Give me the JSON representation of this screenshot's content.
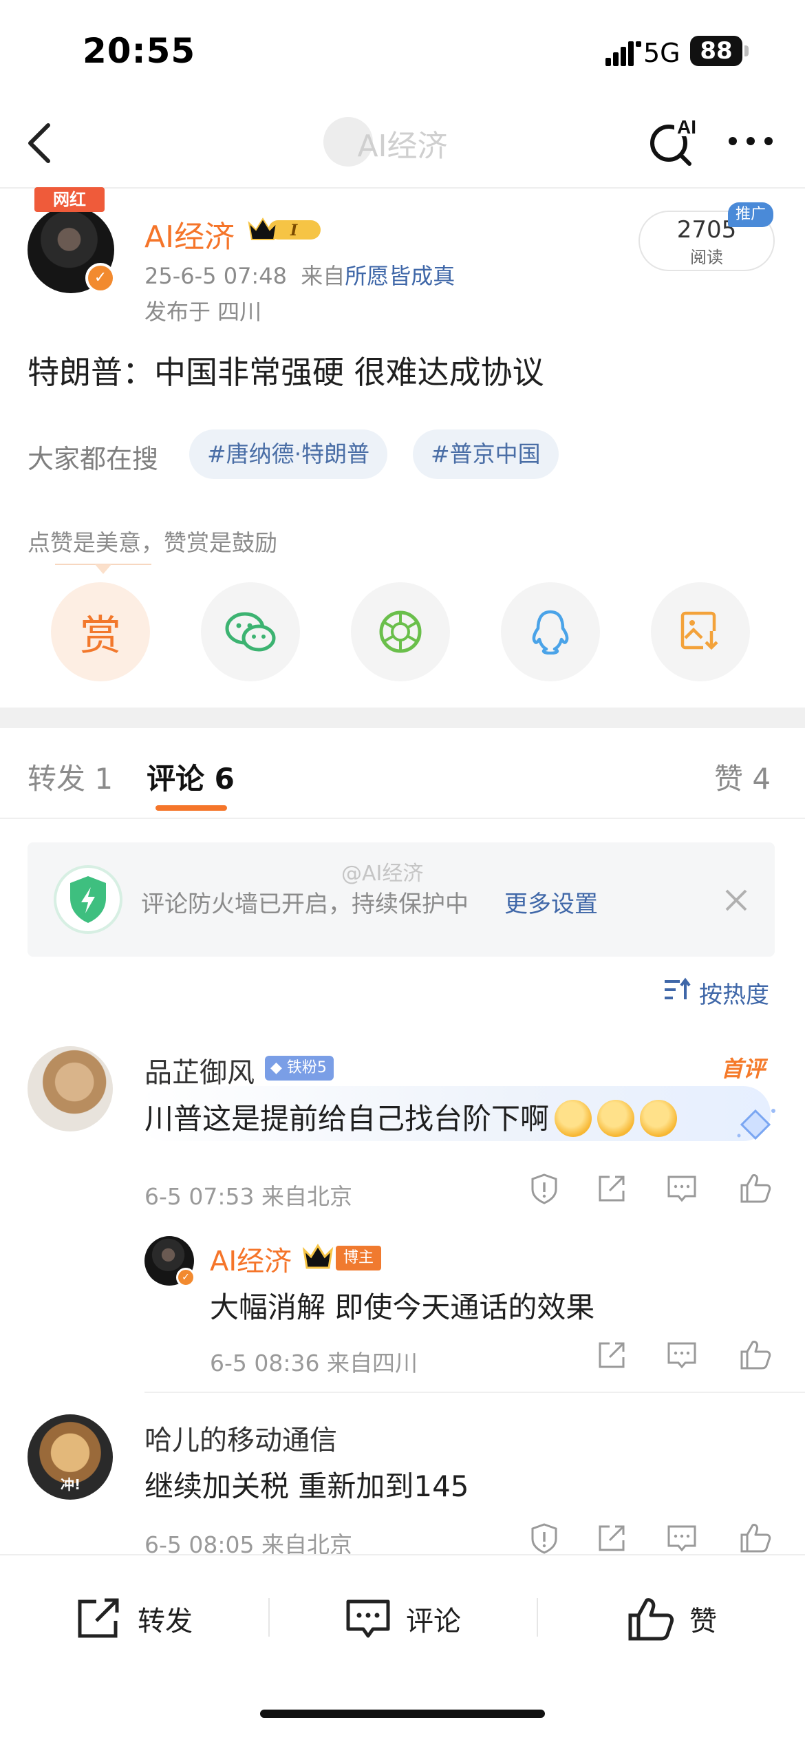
{
  "status_bar": {
    "time": "20:55",
    "network": "5G",
    "battery": "88"
  },
  "nav": {
    "title": "AI经济",
    "icons": [
      "back-icon",
      "search-ai-icon",
      "more-icon"
    ],
    "search_ai_label": "AI"
  },
  "post": {
    "author": "AI经济",
    "author_tag": "网红",
    "level_badge": "I",
    "timestamp": "25-6-5 07:48",
    "source_prefix": "来自",
    "source": "所愿皆成真",
    "location": "发布于 四川",
    "read_count": "2705",
    "read_label": "阅读",
    "ad_tag": "推广",
    "text": "特朗普：中国非常强硬 很难达成协议"
  },
  "search": {
    "label": "大家都在搜",
    "chips": [
      "#唐纳德·特朗普",
      "#普京中国"
    ]
  },
  "reward": {
    "text": "点赞是美意，赞赏是鼓励",
    "reward_glyph": "赏",
    "share_icons": [
      "reward-icon",
      "wechat-icon",
      "moments-icon",
      "qq-icon",
      "save-image-icon"
    ]
  },
  "tabs": [
    {
      "label": "转发 1",
      "active": false
    },
    {
      "label": "评论 6",
      "active": true
    },
    {
      "label": "赞 4",
      "active": false
    }
  ],
  "firewall": {
    "text": "评论防火墙已开启，持续保护中",
    "link": "更多设置",
    "watermark": "@AI经济"
  },
  "sort": {
    "label": "按热度"
  },
  "comments": [
    {
      "user": "品芷御风",
      "badge": "铁粉5",
      "first_tag": "首评",
      "text": "川普这是提前给自己找台阶下啊",
      "emoji_count": 3,
      "meta": "6-5 07:53 来自北京",
      "reply": {
        "user": "AI经济",
        "tag": "博主",
        "text": "大幅消解 即使今天通话的效果",
        "meta": "6-5 08:36 来自四川"
      }
    },
    {
      "user": "哈儿的移动通信",
      "text": "继续加关税 重新加到145",
      "meta": "6-5 08:05 来自北京",
      "avatar_text": "冲!"
    }
  ],
  "bottom_bar": {
    "repost": "转发",
    "comment": "评论",
    "like": "赞"
  },
  "colors": {
    "accent": "#f5752a",
    "link": "#3f67a8",
    "muted": "#8b8b8b"
  }
}
